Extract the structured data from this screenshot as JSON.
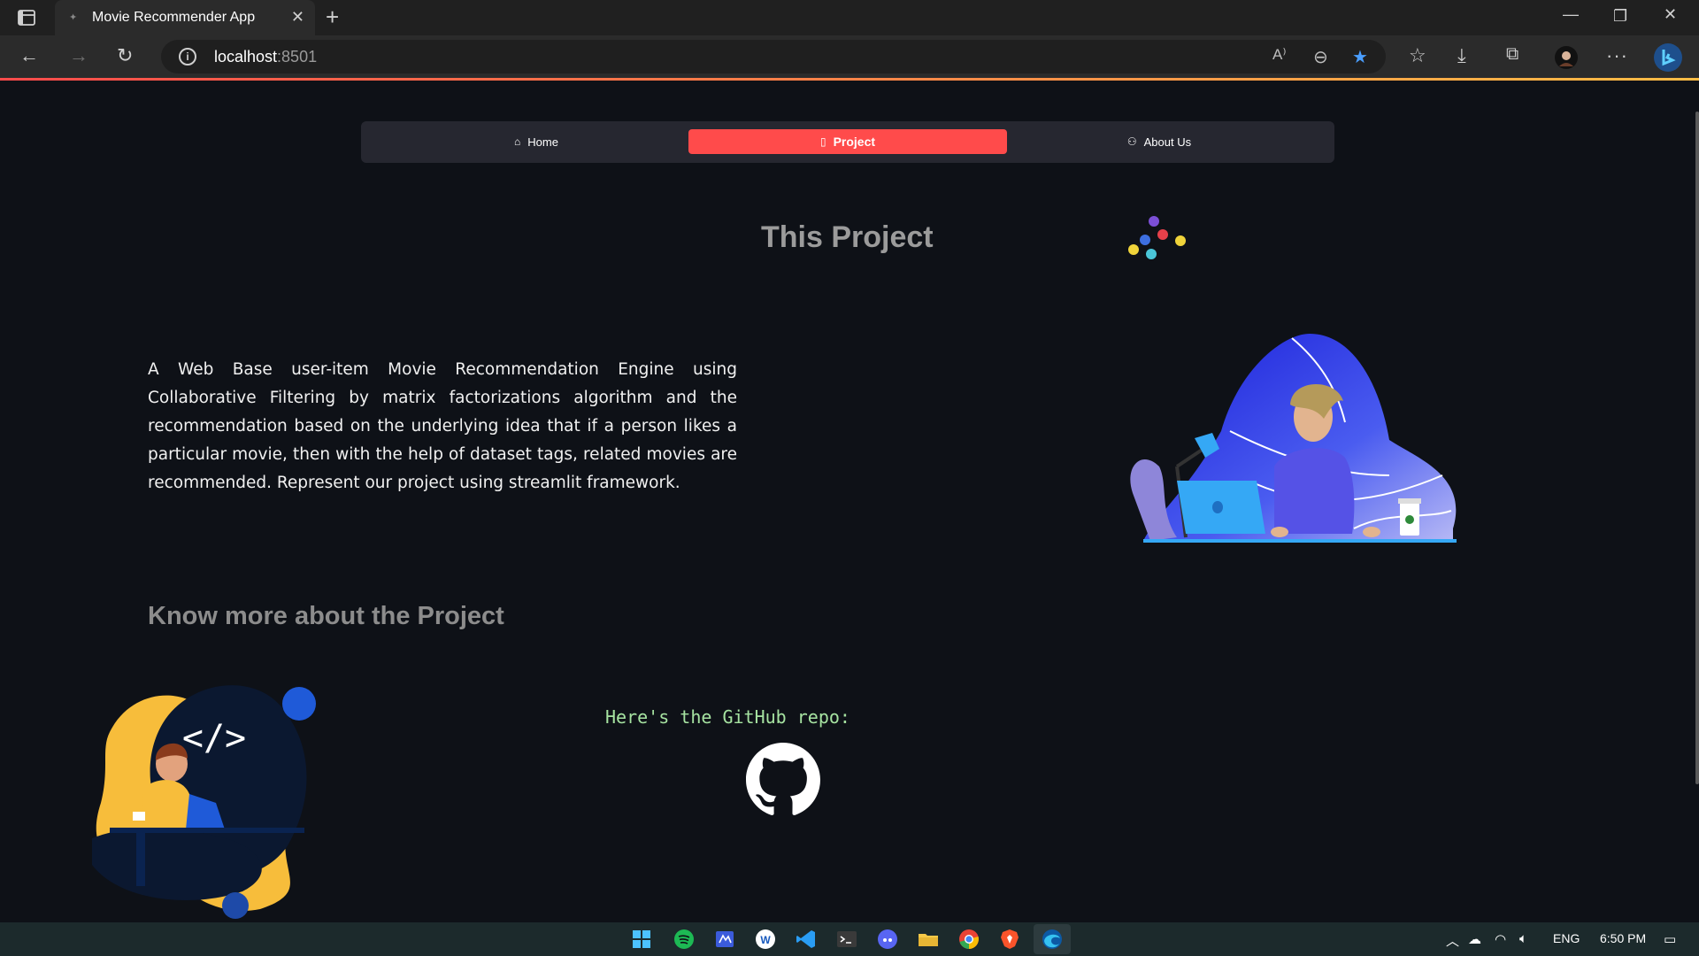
{
  "browser": {
    "tab_title": "Movie Recommender App",
    "tab_close": "✕",
    "new_tab": "+",
    "address_host": "localhost",
    "address_port": ":8501",
    "window_controls": {
      "minimize": "—",
      "restore": "❐",
      "close": "✕"
    }
  },
  "nav": {
    "items": [
      {
        "label": "Home",
        "icon": "house-icon"
      },
      {
        "label": "Project",
        "icon": "document-icon",
        "active": true
      },
      {
        "label": "About Us",
        "icon": "people-icon"
      }
    ]
  },
  "main": {
    "title": "This Project",
    "description": "A Web Base user-item Movie Recommendation Engine using Collaborative Filtering by matrix factorizations algorithm and the recommendation based on the underlying idea that if a person likes a particular movie, then with the help of dataset tags, related movies are recommended. Represent our project using streamlit framework.",
    "subheading": "Know more about the Project",
    "repo_text": "Here's the GitHub repo:"
  },
  "taskbar": {
    "language": "ENG",
    "time": "6:50 PM"
  },
  "colors": {
    "accent": "#ff4b4b",
    "page_bg": "#0e1117",
    "nav_bg": "#262730",
    "repo_text": "#a6e3a1"
  }
}
